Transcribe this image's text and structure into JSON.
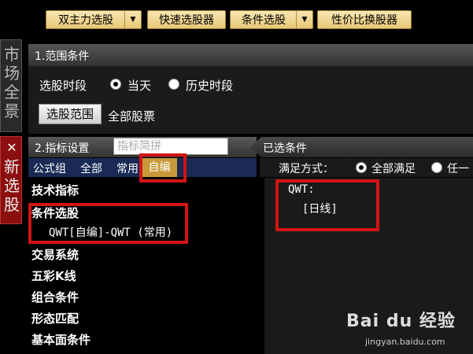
{
  "toolbar": {
    "btn_dual": "双主力选股",
    "btn_quick": "快速选股器",
    "btn_condition": "条件选股",
    "btn_value": "性价比换股器",
    "dropdown_glyph": "▼"
  },
  "side_tabs": {
    "market": "市场全景",
    "new": "新选股",
    "close_glyph": "✕"
  },
  "range": {
    "header": "1.范围条件",
    "period_label": "选股时段",
    "opt_today": "当天",
    "opt_history": "历史时段",
    "range_button": "选股范围",
    "range_value": "全部股票"
  },
  "indicator": {
    "header": "2.指标设置",
    "search_placeholder": "指标简拼",
    "tabs": [
      "公式组",
      "全部",
      "常用",
      "自编"
    ],
    "tree": [
      "技术指标",
      "条件选股",
      "交易系统",
      "五彩K线",
      "组合条件",
      "形态匹配",
      "基本面条件"
    ],
    "formula": "QWT[自编]-QWT (常用)"
  },
  "selected": {
    "header": "已选条件",
    "mode_label": "满足方式：",
    "mode_all": "全部满足",
    "mode_any": "任一",
    "condition_name": "QWT:",
    "condition_period": "[日线]"
  },
  "watermark": {
    "logo": "Bai du 经验",
    "url": "jingyan.baidu.com"
  },
  "colors": {
    "highlight_red": "#d21414",
    "tab_active_gold": "#c89a3a",
    "new_tab_red": "#8b0f0f"
  }
}
